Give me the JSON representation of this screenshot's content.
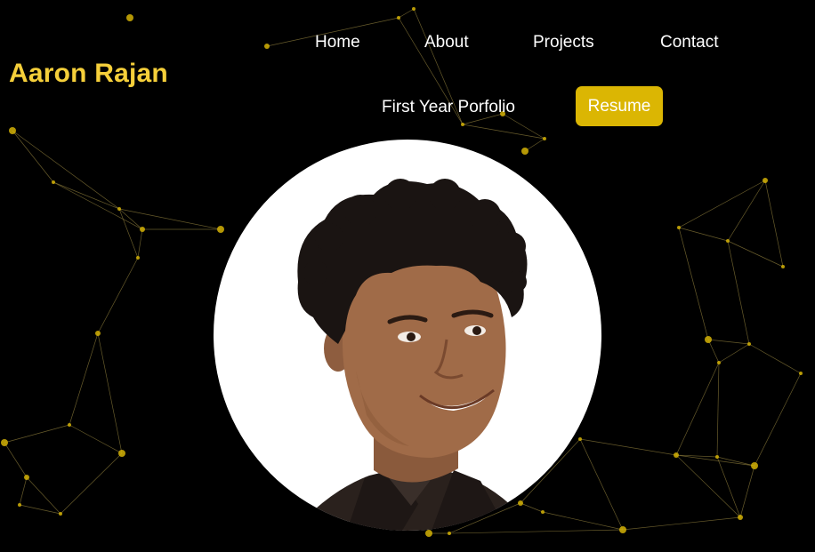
{
  "brand": {
    "name": "Aaron Rajan",
    "color": "#f5cf3a"
  },
  "nav": {
    "items": [
      {
        "label": "Home"
      },
      {
        "label": "About"
      },
      {
        "label": "Projects"
      },
      {
        "label": "Contact"
      },
      {
        "label": "First Year Porfolio"
      }
    ],
    "resume": {
      "label": "Resume",
      "color": "#dbb603"
    }
  },
  "hero": {
    "portrait": {
      "icon": "profile-photo"
    }
  },
  "background": {
    "style": "particle-network",
    "node_color": "#d4b106",
    "line_color": "#8a7a3a"
  }
}
